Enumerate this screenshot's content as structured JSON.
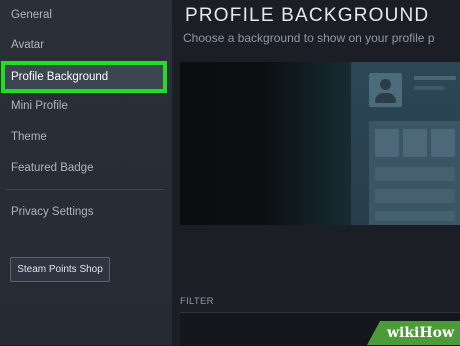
{
  "sidebar": {
    "items": [
      {
        "label": "General"
      },
      {
        "label": "Avatar"
      },
      {
        "label": "Profile Background"
      },
      {
        "label": "Mini Profile"
      },
      {
        "label": "Theme"
      },
      {
        "label": "Featured Badge"
      },
      {
        "label": "Privacy Settings"
      }
    ],
    "active_index": 2,
    "shop_button": "Steam Points Shop"
  },
  "main": {
    "title": "PROFILE BACKGROUND",
    "subtitle": "Choose a background to show on your profile p",
    "filter_label": "FILTER"
  },
  "watermark": {
    "text": "wikiHow"
  },
  "colors": {
    "highlight": "#22dd22",
    "sidebar_bg": "#2a2f38",
    "active_item_bg": "#3d4452",
    "watermark_bg": "#4d9a3a"
  }
}
